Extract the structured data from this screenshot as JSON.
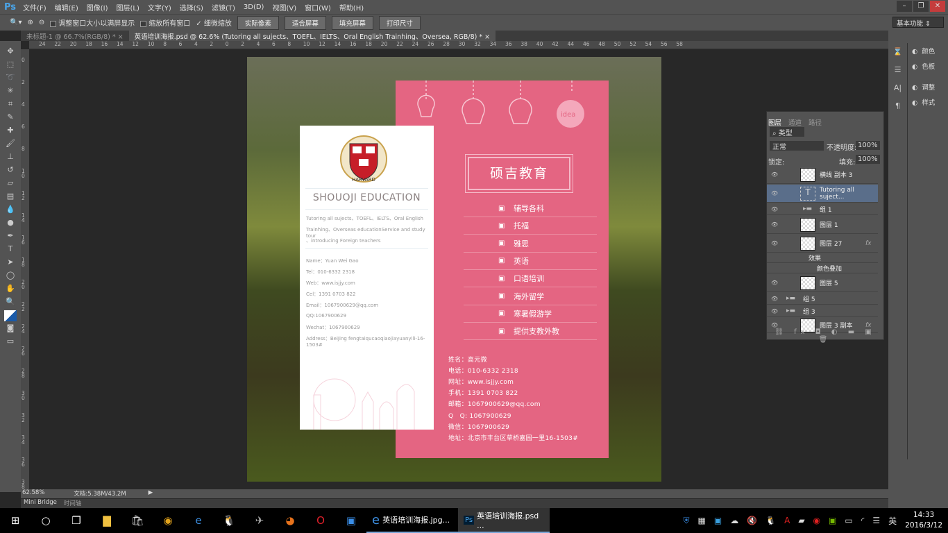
{
  "app": {
    "logo": "Ps",
    "menus": [
      "文件(F)",
      "编辑(E)",
      "图像(I)",
      "图层(L)",
      "文字(Y)",
      "选择(S)",
      "滤镜(T)",
      "3D(D)",
      "视图(V)",
      "窗口(W)",
      "帮助(H)"
    ]
  },
  "options": {
    "resize_windows": "调整窗口大小以满屏显示",
    "resize_windows_checked": false,
    "zoom_all": "缩放所有窗口",
    "zoom_all_checked": false,
    "scrubby": "细微缩放",
    "scrubby_checked": true,
    "buttons": [
      "实际像素",
      "适合屏幕",
      "填充屏幕",
      "打印尺寸"
    ],
    "workspace": "基本功能"
  },
  "tabs": [
    {
      "label": "未标题-1 @ 66.7%(RGB/8) *",
      "active": false
    },
    {
      "label": "英语培训海报.psd @ 62.6% (Tutoring all sujects、TOEFL、IELTS、Oral English Trainhing、Oversea, RGB/8) *",
      "active": true
    }
  ],
  "ruler_top": [
    "24",
    "22",
    "20",
    "18",
    "16",
    "14",
    "12",
    "10",
    "8",
    "6",
    "4",
    "2",
    "0",
    "2",
    "4",
    "6",
    "8",
    "10",
    "12",
    "14",
    "16",
    "18",
    "20",
    "22",
    "24",
    "26",
    "28",
    "30",
    "32",
    "34",
    "36",
    "38",
    "40",
    "42",
    "44",
    "46",
    "48",
    "50",
    "52",
    "54",
    "56",
    "58"
  ],
  "ruler_left": [
    "0",
    "2",
    "4",
    "6",
    "8",
    "1 0",
    "1 2",
    "1 4",
    "1 6",
    "1 8",
    "2 0",
    "2 2",
    "2 4",
    "2 6",
    "2 8",
    "3 0",
    "3 2",
    "3 4",
    "3 6",
    "3 8"
  ],
  "poster": {
    "brand_cn": "硕吉教育",
    "brand_en": "SHOUOJI EDUCATION",
    "bulb_text": "idea",
    "services": [
      {
        "icon": "book-icon",
        "label": "辅导各科"
      },
      {
        "icon": "document-icon",
        "label": "托福"
      },
      {
        "icon": "copy-icon",
        "label": "雅思"
      },
      {
        "icon": "translate-icon",
        "label": "英语"
      },
      {
        "icon": "speech-icon",
        "label": "口语培训"
      },
      {
        "icon": "building-icon",
        "label": "海外留学"
      },
      {
        "icon": "location-icon",
        "label": "寒暑假游学"
      },
      {
        "icon": "presentation-icon",
        "label": "提供支教外教"
      }
    ],
    "contact_cn": [
      "姓名：高元微",
      "电话：010-6332 2318",
      "网址：www.isjjy.com",
      "手机：1391 0703 822",
      "邮箱：1067900629@qq.com",
      "Q　Q: 1067900629",
      "微信：1067900629",
      "地址：北京市丰台区草桥嘉园一里16-1503#"
    ],
    "card_desc": [
      "Tutoring all sujects、TOEFL、IELTS、Oral English",
      "Trainhing、Overseas educationService and study tour",
      "、introducing Foreign teachers"
    ],
    "contact_en": [
      "Name：Yuan Wei Gao",
      "Tel：010-6332 2318",
      "Web：www.isjjy.com",
      "Cel：1391 0703 822",
      "Email：1067900629@qq.com",
      "QQ:1067900629",
      "Wechat：1067900629",
      "Address：BeiJing fengtaiqucaoqiaojiayuanyili-16-1503#"
    ],
    "logo_text": [
      "VE",
      "RI",
      "TAS",
      "HARVARD"
    ],
    "pink": "#e46582"
  },
  "status": {
    "zoom": "62.58%",
    "doc": "文档:5.38M/43.2M"
  },
  "bottom_tabs": [
    "Mini Bridge",
    "时间轴"
  ],
  "right_panel": [
    {
      "icon": "palette-icon",
      "label": "颜色"
    },
    {
      "icon": "swatches-icon",
      "label": "色板"
    },
    {
      "icon": "adjust-icon",
      "label": "调整"
    },
    {
      "icon": "style-icon",
      "label": "样式"
    }
  ],
  "layers": {
    "tabs": [
      "图层",
      "通道",
      "路径"
    ],
    "filter": "类型",
    "blend": "正常",
    "opacity_label": "不透明度:",
    "opacity": "100%",
    "lock_label": "锁定:",
    "fill_label": "填充:",
    "fill": "100%",
    "items": [
      {
        "name": "横线 副本 3",
        "kind": "layer"
      },
      {
        "name": "Tutoring all suject...",
        "kind": "text",
        "selected": true
      },
      {
        "name": "组 1",
        "kind": "group"
      },
      {
        "name": "图层 1",
        "kind": "layer"
      },
      {
        "name": "图层 27",
        "kind": "layer",
        "fx": "fx"
      },
      {
        "name": "效果",
        "kind": "effect"
      },
      {
        "name": "颜色叠加",
        "kind": "effect-item"
      },
      {
        "name": "图层 5",
        "kind": "layer"
      },
      {
        "name": "组 5",
        "kind": "group"
      },
      {
        "name": "组 3",
        "kind": "group"
      },
      {
        "name": "图层 3 副本",
        "kind": "layer",
        "fx": "fx"
      }
    ]
  },
  "taskbar": {
    "apps": [
      {
        "label": "英语培训海报.jpg..."
      },
      {
        "label": "英语培训海报.psd ...",
        "active": true
      }
    ],
    "ime": "英",
    "time": "14:33",
    "date": "2016/3/12"
  }
}
